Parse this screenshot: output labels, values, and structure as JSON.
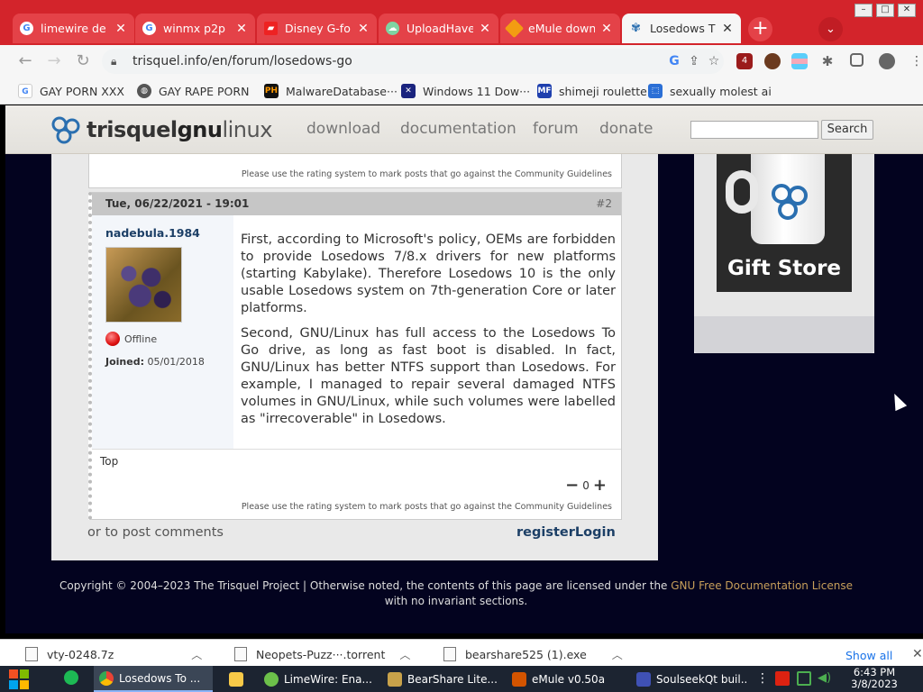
{
  "browser": {
    "tabs": [
      {
        "label": "limewire de",
        "favicon": "google-icon",
        "active": false
      },
      {
        "label": "winmx p2p",
        "favicon": "google-icon",
        "active": false
      },
      {
        "label": "Disney G-fo",
        "favicon": "pdf-icon",
        "active": false
      },
      {
        "label": "UploadHave",
        "favicon": "cloud-icon",
        "active": false
      },
      {
        "label": "eMule down",
        "favicon": "diamond-icon",
        "active": false
      },
      {
        "label": "Losedows T",
        "favicon": "trisquel-icon",
        "active": true
      }
    ],
    "url": "trisquel.info/en/forum/losedows-go",
    "extension_badge": "4",
    "bookmarks": [
      {
        "label": "GAY PORN XXX",
        "icon": "google-icon"
      },
      {
        "label": "GAY RAPE PORN",
        "icon": "globe-icon"
      },
      {
        "label": "MalwareDatabase···",
        "icon": "ph-icon"
      },
      {
        "label": "Windows 11 Dow···",
        "icon": "x-icon"
      },
      {
        "label": "shimeji roulette",
        "icon": "mf-icon"
      },
      {
        "label": "sexually molest ai",
        "icon": "extension-icon"
      }
    ]
  },
  "site": {
    "logo_light": "trisquel",
    "logo_bold": "gnu",
    "logo_tail": "linux",
    "nav": [
      "download",
      "documentation",
      "forum",
      "donate"
    ],
    "search_button": "Search",
    "guideline_text": "Please use the rating system to mark posts that go against the Community Guidelines",
    "post": {
      "date": "Tue, 06/22/2021 - 19:01",
      "number": "#2",
      "author": "nadebula.1984",
      "status": "Offline",
      "joined_label": "Joined:",
      "joined_date": "05/01/2018",
      "paragraphs": [
        "First, according to Microsoft's policy, OEMs are forbidden to provide Losedows 7/8.x drivers for new platforms (starting Kabylake). Therefore Losedows 10 is the only usable Losedows system on 7th-generation Core or later platforms.",
        "Second, GNU/Linux has full access to the Losedows To Go drive, as long as fast boot is disabled. In fact, GNU/Linux has better NTFS support than Losedows. For example, I managed to repair several damaged NTFS volumes in GNU/Linux, while such volumes were labelled as \"irrecoverable\" in Losedows."
      ],
      "top_link": "Top",
      "rating": "0"
    },
    "comments_note": "or to post comments",
    "register": "register",
    "login": "Login",
    "gift_store": "Gift Store",
    "footer_pre": "Copyright © 2004–2023 The Trisquel Project | Otherwise noted, the contents of this page are licensed under the ",
    "footer_link": "GNU Free Documentation License",
    "footer_post": " with no invariant sections."
  },
  "downloads": {
    "items": [
      "vty-0248.7z",
      "Neopets-Puzz···.torrent",
      "bearshare525 (1).exe"
    ],
    "show_all": "Show all"
  },
  "taskbar": {
    "items": [
      {
        "label": "Losedows To ...",
        "active": true
      },
      {
        "label": "",
        "active": false
      },
      {
        "label": "LimeWire: Ena...",
        "active": false
      },
      {
        "label": "BearShare Lite...",
        "active": false
      },
      {
        "label": "eMule v0.50a",
        "active": false
      },
      {
        "label": "SoulseekQt buil...",
        "active": false
      }
    ],
    "time": "6:43 PM",
    "date": "3/8/2023"
  },
  "colors": {
    "tab_red": "#d3242b",
    "page_bg": "#03031f",
    "link_blue": "#1c3f66"
  }
}
